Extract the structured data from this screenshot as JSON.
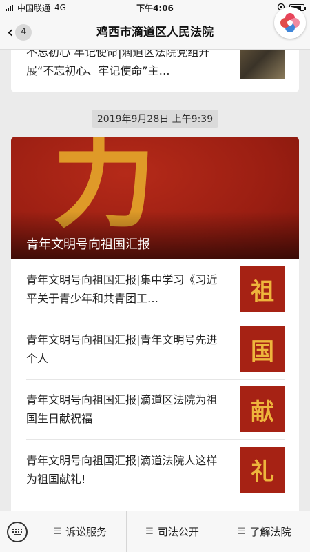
{
  "status_bar": {
    "carrier": "中国联通",
    "network": "4G",
    "time": "下午4:06",
    "battery_level": 0.85
  },
  "nav": {
    "back_count": "4",
    "title": "鸡西市滴道区人民法院"
  },
  "feed": {
    "previous_article_text": "不忘初心 牢记使命|滴道区法院党组开展“不忘初心、牢记使命”主…",
    "timestamp": "2019年9月28日 上午9:39",
    "cover": {
      "title": "青年文明号向祖国汇报",
      "brush_glyph": "力"
    },
    "articles": [
      {
        "title": "青年文明号向祖国汇报|集中学习《习近平关于青少年和共青团工…",
        "thumb_glyph": "祖"
      },
      {
        "title": "青年文明号向祖国汇报|青年文明号先进个人",
        "thumb_glyph": "国"
      },
      {
        "title": "青年文明号向祖国汇报|滴道区法院为祖国生日献祝福",
        "thumb_glyph": "献"
      },
      {
        "title": "青年文明号向祖国汇报|滴道法院人这样为祖国献礼!",
        "thumb_glyph": "礼"
      }
    ]
  },
  "bottom_menu": {
    "items": [
      {
        "label": "诉讼服务",
        "icon": "menu-lines-icon"
      },
      {
        "label": "司法公开",
        "icon": "menu-lines-icon"
      },
      {
        "label": "了解法院",
        "icon": "menu-lines-icon"
      }
    ]
  },
  "colors": {
    "accent_red": "#a62214",
    "gold": "#eeb53c",
    "background": "#ebebeb"
  }
}
